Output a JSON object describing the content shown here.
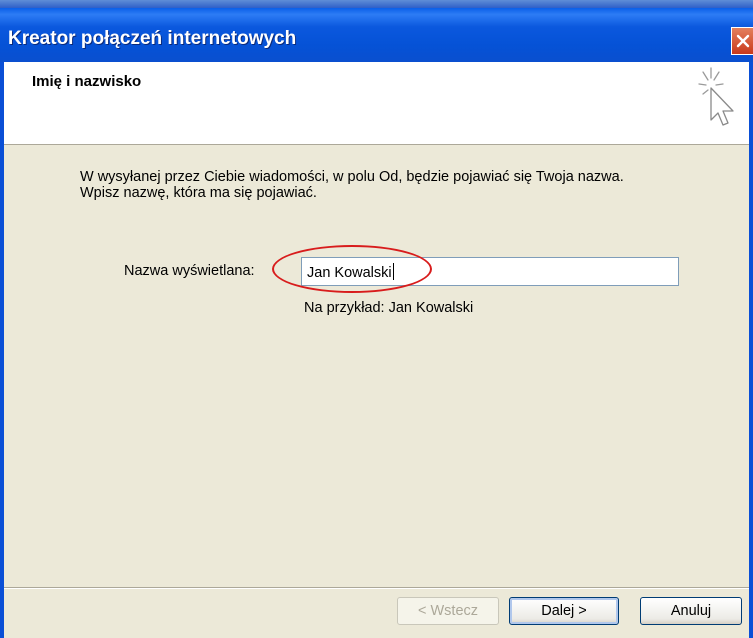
{
  "window": {
    "title": "Kreator połączeń internetowych"
  },
  "header": {
    "title": "Imię i nazwisko",
    "icon": "wizard-cursor-icon"
  },
  "description": {
    "line1": "W wysyłanej przez Ciebie wiadomości, w polu Od, będzie pojawiać się Twoja nazwa.",
    "line2": "Wpisz nazwę, która ma się pojawiać."
  },
  "form": {
    "display_name_label": "Nazwa wyświetlana:",
    "display_name_value": "Jan Kowalski",
    "example_hint": "Na przykład: Jan Kowalski"
  },
  "buttons": {
    "back_label": "< Wstecz",
    "next_label": "Dalej >",
    "cancel_label": "Anuluj"
  },
  "colors": {
    "titlebar": "#0a5fe8",
    "dialog_background": "#ece9d8",
    "highlight_annotation": "#d81c1c",
    "close_button": "#c9391b"
  }
}
